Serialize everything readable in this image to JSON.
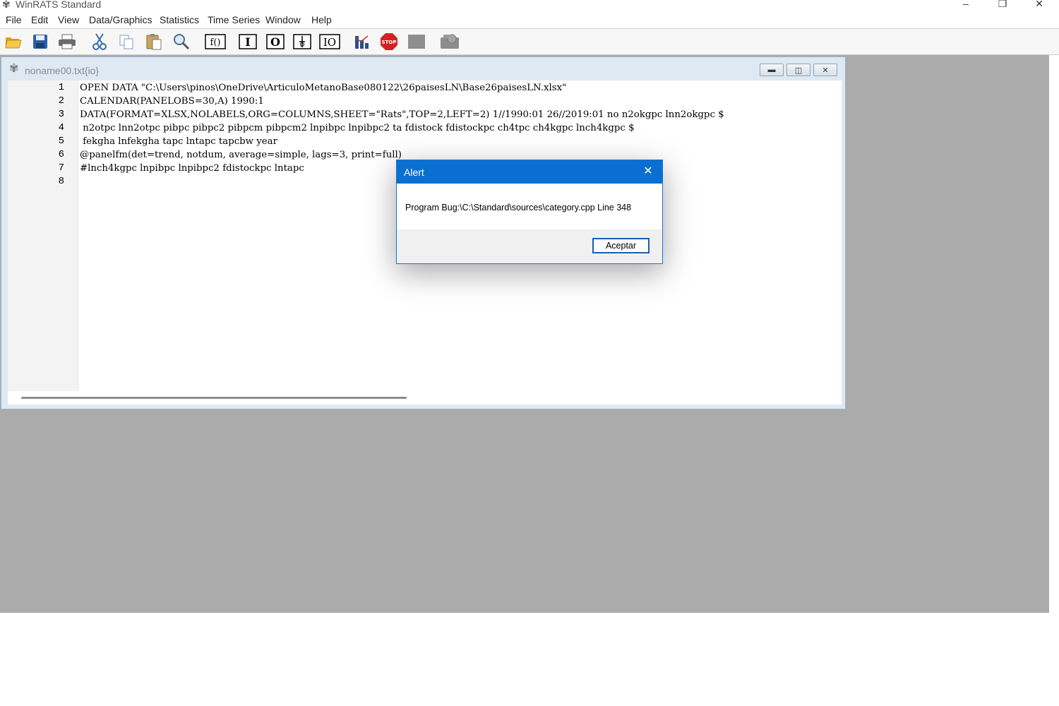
{
  "app": {
    "title": "WinRATS Standard"
  },
  "menu": [
    "File",
    "Edit",
    "View",
    "Data/Graphics",
    "Statistics",
    "Time Series",
    "Window",
    "Help"
  ],
  "window_controls": {
    "minimize": "–",
    "restore": "❐",
    "close": "✕"
  },
  "toolbar": [
    {
      "name": "open-folder-icon"
    },
    {
      "name": "save-icon"
    },
    {
      "name": "print-icon"
    },
    {
      "name": "cut-icon"
    },
    {
      "name": "copy-icon"
    },
    {
      "name": "paste-icon"
    },
    {
      "name": "find-icon"
    },
    {
      "name": "function-icon",
      "label": "f()"
    },
    {
      "name": "input-icon",
      "label": "I"
    },
    {
      "name": "output-icon",
      "label": "O"
    },
    {
      "name": "io-split-icon"
    },
    {
      "name": "io-icon",
      "label": "IO"
    },
    {
      "name": "chart-icon"
    },
    {
      "name": "stop-icon",
      "label": "STOP"
    },
    {
      "name": "gray-box-icon"
    },
    {
      "name": "wizard-icon"
    }
  ],
  "document": {
    "title": "noname00.txt{io}",
    "line_numbers": [
      "1",
      "2",
      "3",
      "4",
      "5",
      "6",
      "7",
      "8"
    ],
    "lines": [
      "OPEN DATA \"C:\\Users\\pinos\\OneDrive\\ArticuloMetanoBase080122\\26paisesLN\\Base26paisesLN.xlsx\"",
      "CALENDAR(PANELOBS=30,A) 1990:1",
      "DATA(FORMAT=XLSX,NOLABELS,ORG=COLUMNS,SHEET=\"Rats\",TOP=2,LEFT=2) 1//1990:01 26//2019:01 no n2okgpc lnn2okgpc $",
      " n2otpc lnn2otpc pibpc pibpc2 pibpcm pibpcm2 lnpibpc lnpibpc2 ta fdistock fdistockpc ch4tpc ch4kgpc lnch4kgpc $",
      " fekgha lnfekgha tapc lntapc tapcbw year",
      "@panelfm(det=trend, notdum, average=simple, lags=3, print=full)",
      "#lnch4kgpc lnpibpc lnpibpc2 fdistockpc lntapc",
      ""
    ]
  },
  "alert": {
    "title": "Alert",
    "message": "Program Bug:\\C:\\Standard\\sources\\category.cpp Line 348",
    "button": "Aceptar"
  }
}
